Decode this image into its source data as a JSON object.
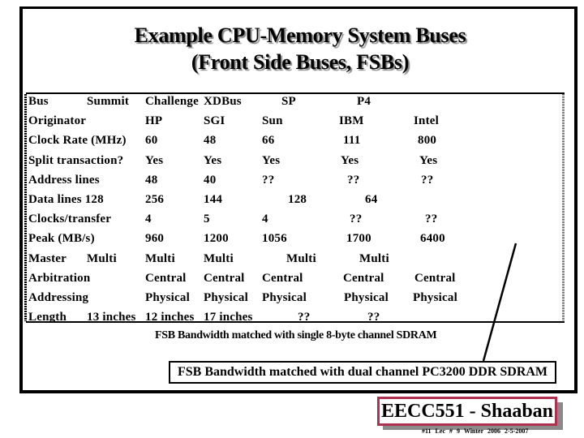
{
  "slide": {
    "title_line1": "Example CPU-Memory System Buses",
    "title_line2": "(Front Side Buses, FSBs)",
    "table": {
      "rows": [
        {
          "label": "Bus",
          "c0": "Summit",
          "c1": "Challenge",
          "c2": "XDBus",
          "c3": "SP",
          "c4": "P4",
          "c5": ""
        },
        {
          "label": "Originator",
          "c0": "",
          "c1": "HP",
          "c2": "SGI",
          "c3": "Sun",
          "c4": "IBM",
          "c5": "Intel"
        },
        {
          "label": "Clock Rate (MHz)",
          "c0": "",
          "c1": "60",
          "c2": "48",
          "c3": "66",
          "c4": "111",
          "c5": "800"
        },
        {
          "label": "Split transaction?",
          "c0": "",
          "c1": "Yes",
          "c2": "Yes",
          "c3": "Yes",
          "c4": "Yes",
          "c5": "Yes"
        },
        {
          "label": "Address lines",
          "c0": "",
          "c1": "48",
          "c2": "40",
          "c3": "??",
          "c4": "??",
          "c5": "??"
        },
        {
          "label": "Data lines 128",
          "c0": "",
          "c1": "256",
          "c2": "144",
          "c3": "128",
          "c4": "64",
          "c5": ""
        },
        {
          "label": "Clocks/transfer",
          "c0": "",
          "c1": "4",
          "c2": "5",
          "c3": "4",
          "c4": "??",
          "c5": "??"
        },
        {
          "label": "Peak (MB/s)",
          "c0": "",
          "c1": "960",
          "c2": "1200",
          "c3": "1056",
          "c4": "1700",
          "c5": "6400"
        },
        {
          "label": "Master",
          "c0": "Multi",
          "c1": "Multi",
          "c2": "Multi",
          "c3": "Multi",
          "c4": "Multi",
          "c5": ""
        },
        {
          "label": "Arbitration",
          "c0": "",
          "c1": "Central",
          "c2": "Central",
          "c3": "Central",
          "c4": "Central",
          "c5": "Central"
        },
        {
          "label": "Addressing",
          "c0": "",
          "c1": "Physical",
          "c2": "Physical",
          "c3": "Physical",
          "c4": "Physical",
          "c5": "Physical"
        },
        {
          "label": "Length",
          "c0": "13 inches",
          "c1": "12 inches",
          "c2": "17 inches",
          "c3": "??",
          "c4": "??",
          "c5": ""
        }
      ]
    },
    "note_single": "FSB Bandwidth matched with single 8-byte channel SDRAM",
    "note_dual": "FSB Bandwidth matched with dual channel PC3200 DDR SDRAM",
    "badge": "EECC551 - Shaaban",
    "footer": "#11  Lec # 9  Winter 2006  2-5-2007"
  }
}
